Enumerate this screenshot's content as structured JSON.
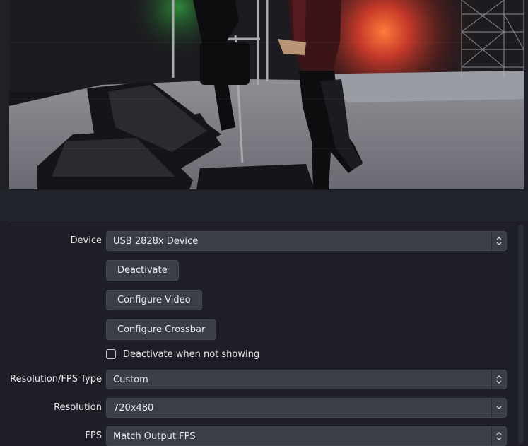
{
  "preview": {
    "description_icon": "video-frame"
  },
  "properties": {
    "device": {
      "label": "Device",
      "value": "USB 2828x Device"
    },
    "buttons": {
      "deactivate": "Deactivate",
      "configure_video": "Configure Video",
      "configure_crossbar": "Configure Crossbar"
    },
    "deactivate_when_not_showing": {
      "label": "Deactivate when not showing",
      "checked": false
    },
    "resolution_fps_type": {
      "label": "Resolution/FPS Type",
      "value": "Custom"
    },
    "resolution": {
      "label": "Resolution",
      "value": "720x480"
    },
    "fps": {
      "label": "FPS",
      "value": "Match Output FPS"
    }
  },
  "colors": {
    "background": "#1e1f26",
    "control": "#3b3d47",
    "text": "#e8e8ec"
  }
}
